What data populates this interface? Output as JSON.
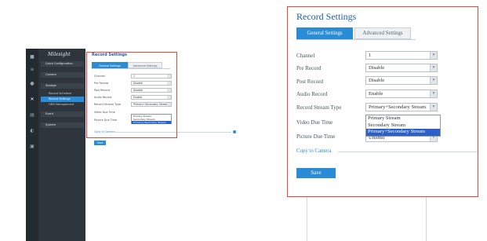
{
  "small": {
    "brand": "Milesight",
    "nav": [
      {
        "label": "Quick Configuration",
        "kind": "head"
      },
      {
        "label": "Camera",
        "kind": "head"
      },
      {
        "label": "Storage",
        "kind": "head"
      },
      {
        "label": "Record Schedule",
        "kind": "sub"
      },
      {
        "label": "Record Settings",
        "kind": "sub-active"
      },
      {
        "label": "HDD Management",
        "kind": "sub"
      },
      {
        "label": "Event",
        "kind": "head"
      },
      {
        "label": "System",
        "kind": "head"
      }
    ],
    "title": "Record Settings",
    "tabs": [
      "General Settings",
      "Advanced Settings"
    ],
    "fields": [
      {
        "label": "Channel",
        "value": "1"
      },
      {
        "label": "Pre Record",
        "value": "Disable"
      },
      {
        "label": "Post Record",
        "value": "Disable"
      },
      {
        "label": "Audio Record",
        "value": "Enable"
      },
      {
        "label": "Record Stream Type",
        "value": "Primary+Secondary Stream"
      },
      {
        "label": "Video Due Time",
        "value": ""
      },
      {
        "label": "Picture Due Time",
        "value": "Unlimit"
      }
    ],
    "dropdown_options": [
      "Primary Stream",
      "Secondary Stream",
      "Primary+Secondary Stream"
    ],
    "copy_label": "Copy to Camera",
    "save_label": "Save"
  },
  "zoom": {
    "title": "Record Settings",
    "tabs": {
      "general": "General Settings",
      "advanced": "Advanced Settings"
    },
    "fields": {
      "channel": {
        "label": "Channel",
        "value": "1"
      },
      "pre_record": {
        "label": "Pre Record",
        "value": "Disable"
      },
      "post_record": {
        "label": "Post Record",
        "value": "Disable"
      },
      "audio_record": {
        "label": "Audio Record",
        "value": "Enable"
      },
      "stream_type": {
        "label": "Record Stream Type",
        "value": "Primary+Secondary Stream"
      },
      "video_due": {
        "label": "Video Due Time"
      },
      "picture_due": {
        "label": "Picture Due Time",
        "value": "Unlimit"
      }
    },
    "dropdown_options": [
      "Primary Stream",
      "Secondary Stream",
      "Primary+Secondary Stream"
    ],
    "copy_label": "Copy to Camera",
    "save_label": "Save"
  },
  "colors": {
    "accent": "#2a8bd6",
    "highlight": "#e0483b",
    "selected": "#2a60c8",
    "title": "#1f5fa8",
    "sidebar": "#2e353d"
  }
}
